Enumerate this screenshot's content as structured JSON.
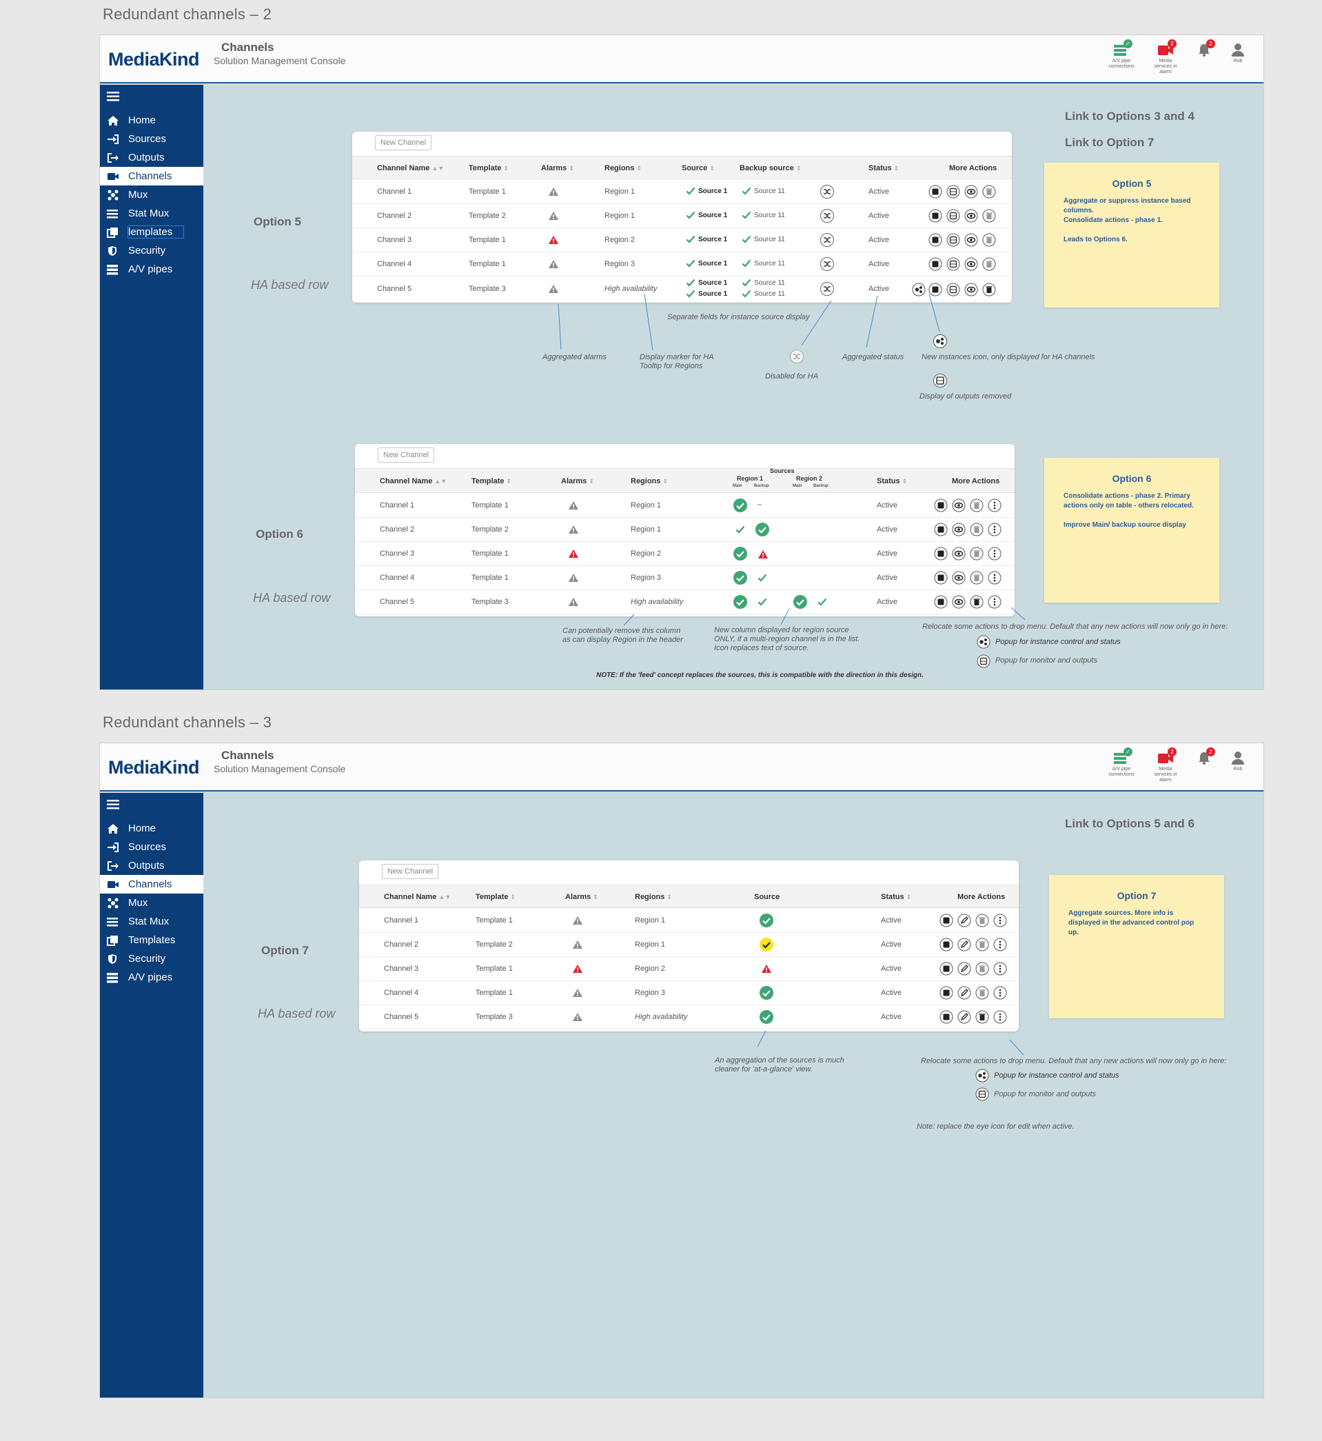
{
  "frame1_title": "Redundant channels – 2",
  "frame2_title": "Redundant channels – 3",
  "app": {
    "logo": "MediaKind",
    "subtitle": "Solution Management Console",
    "av_caption": "A/V pipe connections",
    "media_caption": "Media services in alarm",
    "media_badge": "2",
    "alarm_badge": "2",
    "user": "Rob"
  },
  "nav": [
    "Home",
    "Sources",
    "Outputs",
    "Channels",
    "Mux",
    "Stat Mux",
    "Templates",
    "Security",
    "A/V pipes"
  ],
  "nav_frame1_templates": "lemplates",
  "page_title": "Channels",
  "new_channel": "New Channel",
  "ha_based_row": "HA based row",
  "opt5": {
    "label": "Option 5",
    "links": [
      "Link to Options 3 and 4",
      "Link to Option 7"
    ],
    "headers": {
      "name": "Channel Name",
      "template": "Template",
      "alarms": "Alarms",
      "regions": "Regions",
      "source": "Source",
      "backup": "Backup source",
      "status": "Status",
      "more": "More Actions"
    },
    "rows": [
      {
        "name": "Channel 1",
        "template": "Template 1",
        "alarm": "warn",
        "region": "Region 1",
        "source": "Source 1",
        "backup": "Source 11",
        "status": "Active"
      },
      {
        "name": "Channel 2",
        "template": "Template 2",
        "alarm": "warn",
        "region": "Region 1",
        "source": "Source 1",
        "backup": "Source 11",
        "status": "Active"
      },
      {
        "name": "Channel 3",
        "template": "Template 1",
        "alarm": "alarm",
        "region": "Region 2",
        "source": "Source 1",
        "backup": "Source 11",
        "status": "Active"
      },
      {
        "name": "Channel 4",
        "template": "Template 1",
        "alarm": "warn",
        "region": "Region 3",
        "source": "Source 1",
        "backup": "Source 11",
        "status": "Active"
      },
      {
        "name": "Channel 5",
        "template": "Template 3",
        "alarm": "warn",
        "region": "High availability",
        "source": "Source 1",
        "source2": "Source 1",
        "backup": "Source 11",
        "backup2": "Source 11",
        "status": "Active"
      }
    ],
    "notes": {
      "separate": "Separate fields for instance source display",
      "agg_alarms": "Aggregated alarms",
      "ha_marker": "Display marker for HA",
      "ha_tooltip": "Tooltip for Regions",
      "disabled": "Disabled for HA",
      "agg_status": "Aggregated status",
      "new_icon": "New instances icon, only displayed for HA channels",
      "outputs_removed": "Display of outputs removed"
    },
    "sticky": {
      "title": "Option 5",
      "lines": [
        "Aggregate or suppress instance based columns.",
        "Consolidate actions - phase 1.",
        "",
        "Leads to Options 6."
      ]
    }
  },
  "opt6": {
    "label": "Option 6",
    "headers": {
      "name": "Channel Name",
      "template": "Template",
      "alarms": "Alarms",
      "regions": "Regions",
      "sources": "Sources",
      "region1": "Region 1",
      "region2": "Region 2",
      "main": "Main",
      "backup": "Backup",
      "status": "Status",
      "more": "More Actions"
    },
    "rows": [
      {
        "name": "Channel 1",
        "template": "Template 1",
        "alarm": "warn",
        "region": "Region 1",
        "r1_main": "circle",
        "r1_backup": "dash",
        "r2_main": "",
        "r2_backup": "",
        "status": "Active"
      },
      {
        "name": "Channel 2",
        "template": "Template 2",
        "alarm": "warn",
        "region": "Region 1",
        "r1_main": "check",
        "r1_backup": "circle",
        "r2_main": "",
        "r2_backup": "",
        "status": "Active"
      },
      {
        "name": "Channel 3",
        "template": "Template 1",
        "alarm": "alarm",
        "region": "Region 2",
        "r1_main": "circle",
        "r1_backup": "alarm",
        "r2_main": "",
        "r2_backup": "",
        "status": "Active"
      },
      {
        "name": "Channel 4",
        "template": "Template 1",
        "alarm": "warn",
        "region": "Region 3",
        "r1_main": "circle",
        "r1_backup": "check",
        "r2_main": "",
        "r2_backup": "",
        "status": "Active"
      },
      {
        "name": "Channel 5",
        "template": "Template 3",
        "alarm": "warn",
        "region": "High availability",
        "r1_main": "circle",
        "r1_backup": "check",
        "r2_main": "circle",
        "r2_backup": "check",
        "status": "Active"
      }
    ],
    "notes": {
      "remove_col_1": "Can potentially remove this column",
      "remove_col_2": "as can display Region in the header",
      "new_col_1": "New column displayed for region source",
      "new_col_2": "ONLY, if a multi-region channel is in the list.",
      "new_col_3": "Icon replaces text of source.",
      "relocate": "Relocate some actions to drop menu. Default that any new actions will now only go in here:",
      "popup_instance": "Popup for instance control and status",
      "popup_monitor": "Popup for monitor and outputs",
      "feed_note": "NOTE: If the 'feed' concept replaces the sources, this is compatible with the direction in this design."
    },
    "sticky": {
      "title": "Option 6",
      "lines": [
        "Consolidate actions - phase 2. Primary actions only on table - others relocated.",
        "",
        "Improve Main/ backup source display"
      ]
    }
  },
  "opt7": {
    "label": "Option 7",
    "link": "Link to Options 5 and 6",
    "headers": {
      "name": "Channel Name",
      "template": "Template",
      "alarms": "Alarms",
      "regions": "Regions",
      "source": "Source",
      "status": "Status",
      "more": "More Actions"
    },
    "rows": [
      {
        "name": "Channel 1",
        "template": "Template 1",
        "alarm": "warn",
        "region": "Region 1",
        "source": "ok",
        "status": "Active"
      },
      {
        "name": "Channel 2",
        "template": "Template 2",
        "alarm": "warn",
        "region": "Region 1",
        "source": "partial",
        "status": "Active"
      },
      {
        "name": "Channel 3",
        "template": "Template 1",
        "alarm": "alarm",
        "region": "Region 2",
        "source": "alarm",
        "status": "Active"
      },
      {
        "name": "Channel 4",
        "template": "Template 1",
        "alarm": "warn",
        "region": "Region 3",
        "source": "ok",
        "status": "Active"
      },
      {
        "name": "Channel 5",
        "template": "Template 3",
        "alarm": "warn",
        "region": "High availability",
        "source": "ok",
        "status": "Active"
      }
    ],
    "notes": {
      "agg_1": "An aggregation of the sources is much",
      "agg_2": "cleaner for 'at-a-glance' view.",
      "relocate": "Relocate some actions to drop menu. Default that any new actions will now only go in here:",
      "popup_instance": "Popup for instance control and status",
      "popup_monitor": "Popup for monitor and outputs",
      "eye_note": "Note: replace the eye icon for edit when active."
    },
    "sticky": {
      "title": "Option 7",
      "lines": [
        "Aggregate sources. More info is displayed in the advanced control pop up."
      ]
    }
  },
  "colors": {
    "navy": "#0b3d78",
    "board": "#cadbe0",
    "check": "#3fa573",
    "alarm": "#e0202c",
    "warn": "#8a8a8a",
    "sticky": "#fdf0b7",
    "yellow": "#f5e61c"
  },
  "icons": [
    "menu-icon",
    "home-icon",
    "sources-icon",
    "outputs-icon",
    "channels-icon",
    "mux-icon",
    "stat-mux-icon",
    "templates-icon",
    "security-icon",
    "av-pipes-icon",
    "sort-icon",
    "warning-icon",
    "alarm-icon",
    "check-icon",
    "check-circle-icon",
    "stop-icon",
    "monitor-icon",
    "eye-icon",
    "trash-icon",
    "more-icon",
    "instances-icon",
    "shuffle-icon",
    "edit-icon",
    "bell-icon",
    "user-icon",
    "av-pipe-icon",
    "camera-icon"
  ]
}
